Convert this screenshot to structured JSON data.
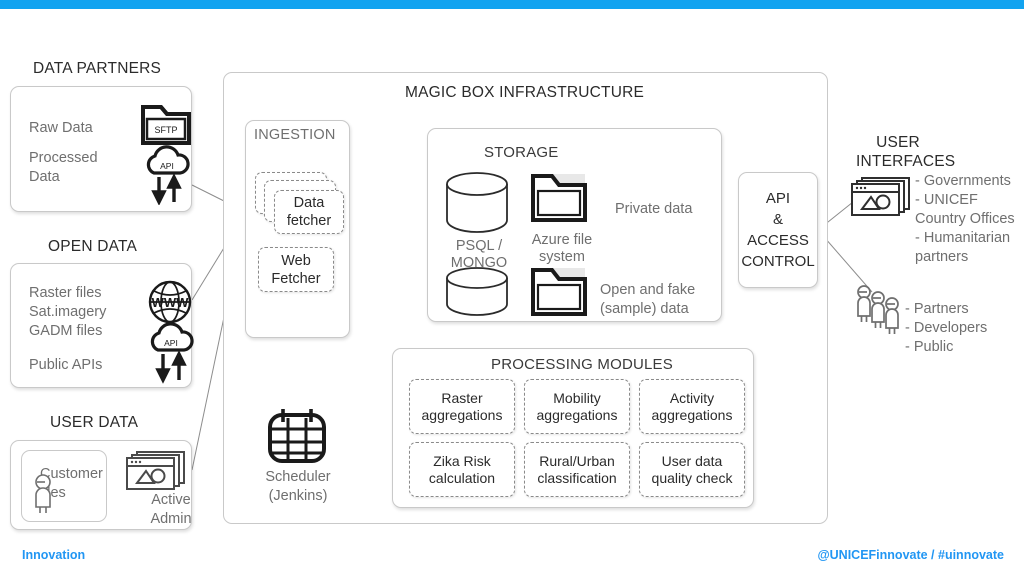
{
  "footer": {
    "left": "Innovation",
    "right": "@UNICEFinnovate / #uinnovate",
    "accent_color": "#2196f3"
  },
  "topbar": {
    "color": "#12a3f0"
  },
  "left_column": {
    "data_partners": {
      "title": "DATA PARTNERS",
      "rows": [
        {
          "label": "Raw Data",
          "icon": "sftp-folder-icon",
          "icon_label": "SFTP"
        },
        {
          "label": "Processed\nData",
          "icon": "api-cloud-icon",
          "icon_label": "API"
        }
      ]
    },
    "open_data": {
      "title": "OPEN DATA",
      "lines": [
        "Raster files",
        "Sat.imagery",
        "GADM files"
      ],
      "line2": "Public APIs",
      "icons": [
        "www-globe-icon",
        "api-cloud-icon"
      ],
      "icon_label": "API"
    },
    "user_data": {
      "title": "USER DATA",
      "customer_files": "Customer\nfiles",
      "customer_icon": "person-icon",
      "active_admin": "Active\nAdmin",
      "admin_icon": "browser-window-icon"
    }
  },
  "infrastructure": {
    "title": "MAGIC BOX INFRASTRUCTURE",
    "ingestion": {
      "title": "INGESTION",
      "data_fetcher": "Data\nfetcher",
      "web_fetcher": "Web\nFetcher"
    },
    "storage": {
      "title": "STORAGE",
      "db_label": "PSQL /\nMONGO",
      "fs_label": "Azure file\nsystem",
      "private_label": "Private data",
      "open_label": "Open and fake\n(sample) data",
      "db_icon": "database-cylinder-icon",
      "folder_icon": "folder-icon"
    },
    "scheduler": {
      "label": "Scheduler\n(Jenkins)",
      "icon": "calendar-grid-icon"
    },
    "processing": {
      "title": "PROCESSING MODULES",
      "modules": [
        "Raster\naggregations",
        "Mobility\naggregations",
        "Activity\naggregations",
        "Zika Risk\ncalculation",
        "Rural/Urban\nclassification",
        "User data\nquality check"
      ]
    }
  },
  "api_box": {
    "label": "API\n&\nACCESS\nCONTROL"
  },
  "user_interfaces": {
    "title": "USER\nINTERFACES",
    "browser_icon": "browser-window-icon",
    "consumers": "- Governments\n- UNICEF\nCountry Offices\n- Humanitarian\npartners",
    "people_icon": "people-group-icon",
    "audience": "- Partners\n- Developers\n- Public"
  }
}
